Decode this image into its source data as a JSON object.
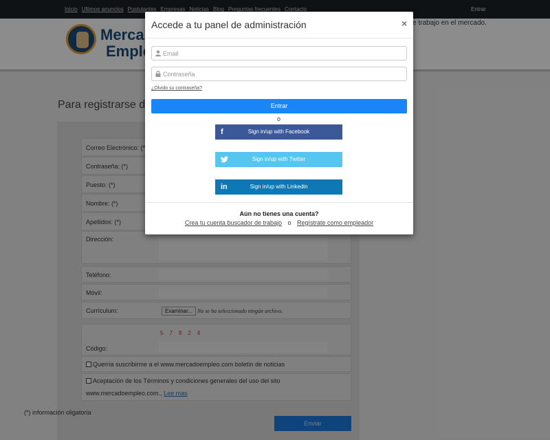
{
  "topnav": {
    "links": [
      "Inicio",
      "Ultimos anuncios",
      "Postulantes",
      "Empresas",
      "Noticias",
      "Blog",
      "Preguntas frecuentes",
      "Contacto"
    ],
    "login": "Entrar"
  },
  "header": {
    "logo_line1": "Merca",
    "logo_line2": "Emple",
    "tagline": "e trabajo en el mercado."
  },
  "register": {
    "title": "Para registrarse de",
    "fields": {
      "email": "Correo Electrónico: (*)",
      "password": "Contraseña: (*)",
      "position": "Puesto: (*)",
      "name": "Nombre: (*)",
      "surname": "Apellidos: (*)",
      "address": "Dirección:",
      "phone": "Teléfono:",
      "mobile": "Móvil:",
      "cv": "Currículum:",
      "code": "Código:"
    },
    "file_button": "Examinar...",
    "file_status": "No se ha seleccionado ningún archivo.",
    "captcha": "57824",
    "newsletter": "Querría suscribirme a el www.mercadoempleo.com boletín de noticias",
    "terms_line1": "Aceptación de los Términos y condiciones generales del uso del sito",
    "terms_line2": "www.mercadoempleo.com.,",
    "terms_link": "Lee mas",
    "obligatory": "(*) información oligatoria",
    "submit": "Enviar"
  },
  "modal": {
    "title": "Accede a tu panel de administración",
    "close": "×",
    "email_placeholder": "Email",
    "password_placeholder": "Contraseña",
    "forgot": "¿Olvido su contraseña?",
    "login_button": "Entrar",
    "or": "o",
    "facebook": "Sign in/up with Facebook",
    "twitter": "Sign in/up with Twitter",
    "linkedin": "Sign in/up with Linkedin",
    "no_account": "Aún no tienes una cuenta?",
    "register_seeker": "Crea tu cuenta buscador de trabajo",
    "or2": "o",
    "register_employer": "Regístrate como empleador"
  },
  "colors": {
    "primary": "#1a85f6",
    "facebook": "#3b5998",
    "twitter": "#55c6ef",
    "linkedin": "#0e77b5"
  },
  "icons": {
    "email": "user-icon",
    "password": "lock-icon",
    "facebook": "facebook-icon",
    "twitter": "twitter-icon",
    "linkedin": "linkedin-icon"
  }
}
